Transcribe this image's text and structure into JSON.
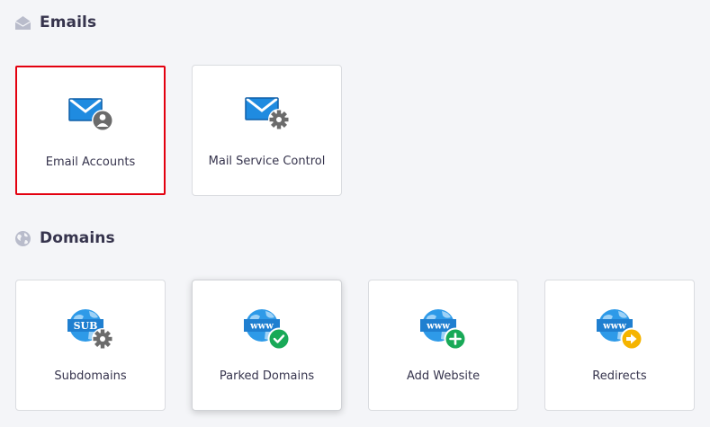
{
  "sections": {
    "emails": {
      "title": "Emails",
      "icon": "envelope-open-icon",
      "cards": [
        {
          "label": "Email Accounts",
          "icon": "email-accounts-icon",
          "selected": true
        },
        {
          "label": "Mail Service Control",
          "icon": "mail-service-control-icon"
        }
      ]
    },
    "domains": {
      "title": "Domains",
      "icon": "globe-icon",
      "cards": [
        {
          "label": "Subdomains",
          "icon": "subdomains-icon",
          "badge_text": "SUB"
        },
        {
          "label": "Parked Domains",
          "icon": "parked-domains-icon",
          "badge_text": "www",
          "hovered": true
        },
        {
          "label": "Add Website",
          "icon": "add-website-icon",
          "badge_text": "www"
        },
        {
          "label": "Redirects",
          "icon": "redirects-icon",
          "badge_text": "www"
        }
      ]
    }
  },
  "colors": {
    "selected_border": "#e3000f",
    "icon_blue": "#1f8be0",
    "icon_dark_blue": "#0f5fa8",
    "gear_gray": "#6b6b6b",
    "check_green": "#18a957",
    "arrow_yellow": "#f5b400",
    "heading_text": "#36344d"
  }
}
